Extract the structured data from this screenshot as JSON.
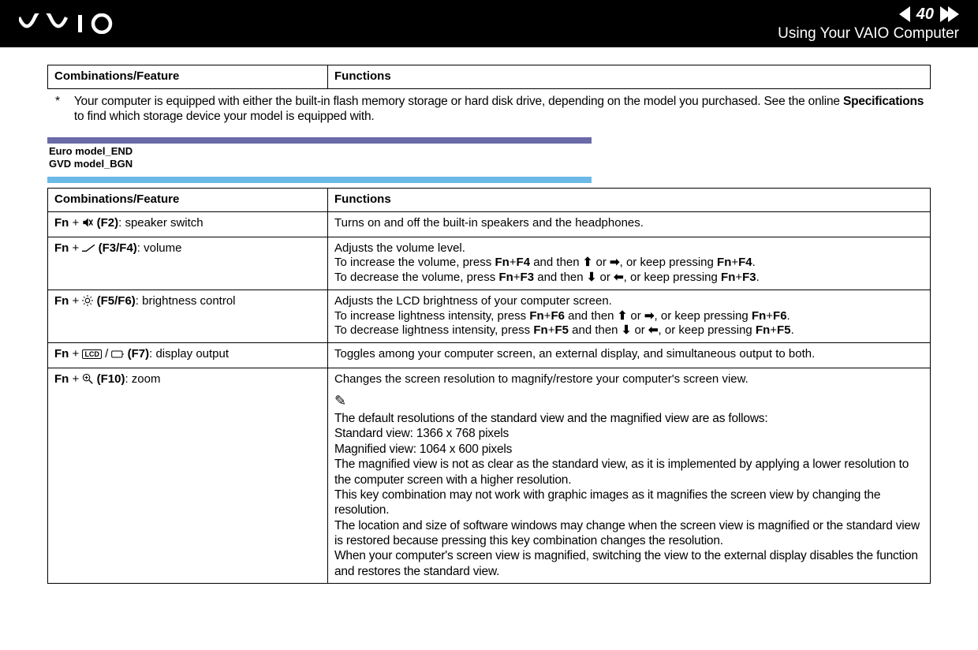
{
  "header": {
    "page_number": "40",
    "title": "Using Your VAIO Computer"
  },
  "top_table": {
    "col1": "Combinations/Feature",
    "col2": "Functions"
  },
  "footnote": {
    "marker": "*",
    "text_a": "Your computer is equipped with either the built-in flash memory storage or hard disk drive, depending on the model you purchased. See the online ",
    "text_b": "Specifications",
    "text_c": " to find which storage device your model is equipped with."
  },
  "model_tags": {
    "line1": "Euro model_END",
    "line2": "GVD model_BGN"
  },
  "table": {
    "head": {
      "c1": "Combinations/Feature",
      "c2": "Functions"
    },
    "rows": {
      "r1": {
        "feat_pre": "Fn",
        "feat_key": " (F2)",
        "feat_suffix": ": speaker switch",
        "func": "Turns on and off the built-in speakers and the headphones."
      },
      "r2": {
        "feat_pre": "Fn",
        "feat_key": " (F3/F4)",
        "feat_suffix": ": volume",
        "func_l1": "Adjusts the volume level.",
        "func_l2a": "To increase the volume, press ",
        "func_l2b": "Fn",
        "func_l2c": "+",
        "func_l2d": "F4",
        "func_l2e": " and then ",
        "func_l2f": " or ",
        "func_l2g": ", or keep pressing ",
        "func_l2h": "Fn",
        "func_l2i": "+",
        "func_l2j": "F4",
        "func_l2k": ".",
        "func_l3a": "To decrease the volume, press ",
        "func_l3b": "Fn",
        "func_l3c": "+",
        "func_l3d": "F3",
        "func_l3e": " and then ",
        "func_l3f": " or ",
        "func_l3g": ", or keep pressing ",
        "func_l3h": "Fn",
        "func_l3i": "+",
        "func_l3j": "F3",
        "func_l3k": "."
      },
      "r3": {
        "feat_pre": "Fn",
        "feat_key": " (F5/F6)",
        "feat_suffix": ": brightness control",
        "func_l1": "Adjusts the LCD brightness of your computer screen.",
        "func_l2a": "To increase lightness intensity, press ",
        "func_l2b": "Fn",
        "func_l2c": "+",
        "func_l2d": "F6",
        "func_l2e": " and then ",
        "func_l2f": " or ",
        "func_l2g": ", or keep pressing ",
        "func_l2h": "Fn",
        "func_l2i": "+",
        "func_l2j": "F6",
        "func_l2k": ".",
        "func_l3a": "To decrease lightness intensity, press ",
        "func_l3b": "Fn",
        "func_l3c": "+",
        "func_l3d": "F5",
        "func_l3e": " and then ",
        "func_l3f": " or ",
        "func_l3g": ", or keep pressing ",
        "func_l3h": "Fn",
        "func_l3i": "+",
        "func_l3j": "F5",
        "func_l3k": "."
      },
      "r4": {
        "feat_pre": "Fn",
        "lcd": "LCD",
        "feat_key": " (F7)",
        "feat_suffix": ": display output",
        "func": "Toggles among your computer screen, an external display, and simultaneous output to both."
      },
      "r5": {
        "feat_pre": "Fn",
        "feat_key": " (F10)",
        "feat_suffix": ": zoom",
        "func_top": "Changes the screen resolution to magnify/restore your computer's screen view.",
        "pencil": "✎",
        "p1": "The default resolutions of the standard view and the magnified view are as follows:",
        "p2": "Standard view: 1366 x 768 pixels",
        "p3": "Magnified view: 1064 x 600 pixels",
        "p4": "The magnified view is not as clear as the standard view, as it is implemented by applying a lower resolution to the computer screen with a higher resolution.",
        "p5": "This key combination may not work with graphic images as it magnifies the screen view by changing the resolution.",
        "p6": "The location and size of software windows may change when the screen view is magnified or the standard view is restored because pressing this key combination changes the resolution.",
        "p7": "When your computer's screen view is magnified, switching the view to the external display disables the function and restores the standard view."
      }
    }
  },
  "arrows": {
    "up": "⬆",
    "down": "⬇",
    "right": "➡",
    "left": "⬅"
  }
}
